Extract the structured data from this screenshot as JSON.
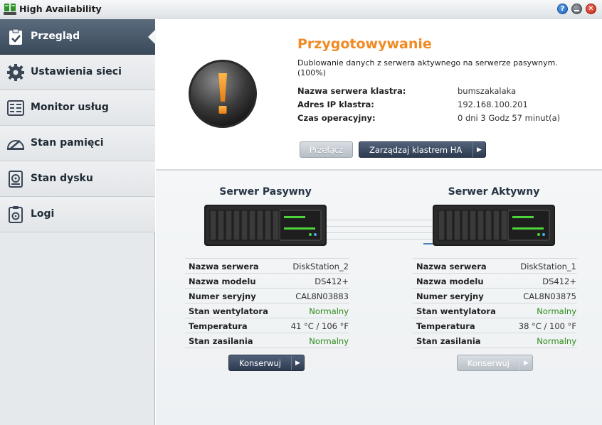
{
  "window": {
    "title": "High Availability",
    "help": "?",
    "close": "✕"
  },
  "sidebar": {
    "items": [
      {
        "label": "Przegląd",
        "icon": "clipboard-check-icon",
        "active": true
      },
      {
        "label": "Ustawienia sieci",
        "icon": "gear-icon",
        "active": false
      },
      {
        "label": "Monitor usług",
        "icon": "service-monitor-icon",
        "active": false
      },
      {
        "label": "Stan pamięci",
        "icon": "storage-gauge-icon",
        "active": false
      },
      {
        "label": "Stan dysku",
        "icon": "hard-disk-icon",
        "active": false
      },
      {
        "label": "Logi",
        "icon": "log-document-icon",
        "active": false
      }
    ]
  },
  "overview": {
    "status_title": "Przygotowywanie",
    "status_description": "Dublowanie danych z serwera aktywnego na serwerze pasywnym. (100%)",
    "cluster_name_label": "Nazwa serwera klastra:",
    "cluster_name_value": "bumszakalaka",
    "cluster_ip_label": "Adres IP klastra:",
    "cluster_ip_value": "192.168.100.201",
    "uptime_label": "Czas operacyjny:",
    "uptime_value": "0 dni 3 Godz 57 minut(a)",
    "switch_button": "Przełącz",
    "manage_button": "Zarządzaj klastrem HA"
  },
  "passive_server": {
    "title": "Serwer Pasywny",
    "rows": [
      {
        "label": "Nazwa serwera",
        "value": "DiskStation_2",
        "ok": false
      },
      {
        "label": "Nazwa modelu",
        "value": "DS412+",
        "ok": false
      },
      {
        "label": "Numer seryjny",
        "value": "CAL8N03883",
        "ok": false
      },
      {
        "label": "Stan wentylatora",
        "value": "Normalny",
        "ok": true
      },
      {
        "label": "Temperatura",
        "value": "41 °C / 106 °F",
        "ok": false
      },
      {
        "label": "Stan zasilania",
        "value": "Normalny",
        "ok": true
      }
    ],
    "button": "Konserwuj"
  },
  "active_server": {
    "title": "Serwer Aktywny",
    "rows": [
      {
        "label": "Nazwa serwera",
        "value": "DiskStation_1",
        "ok": false
      },
      {
        "label": "Nazwa modelu",
        "value": "DS412+",
        "ok": false
      },
      {
        "label": "Numer seryjny",
        "value": "CAL8N03875",
        "ok": false
      },
      {
        "label": "Stan wentylatora",
        "value": "Normalny",
        "ok": true
      },
      {
        "label": "Temperatura",
        "value": "38 °C / 100 °F",
        "ok": false
      },
      {
        "label": "Stan zasilania",
        "value": "Normalny",
        "ok": true
      }
    ],
    "button": "Konserwuj"
  },
  "colors": {
    "accent": "#f08a24",
    "ok": "#2d8a1a",
    "nav_active": "#3a4a5b"
  }
}
